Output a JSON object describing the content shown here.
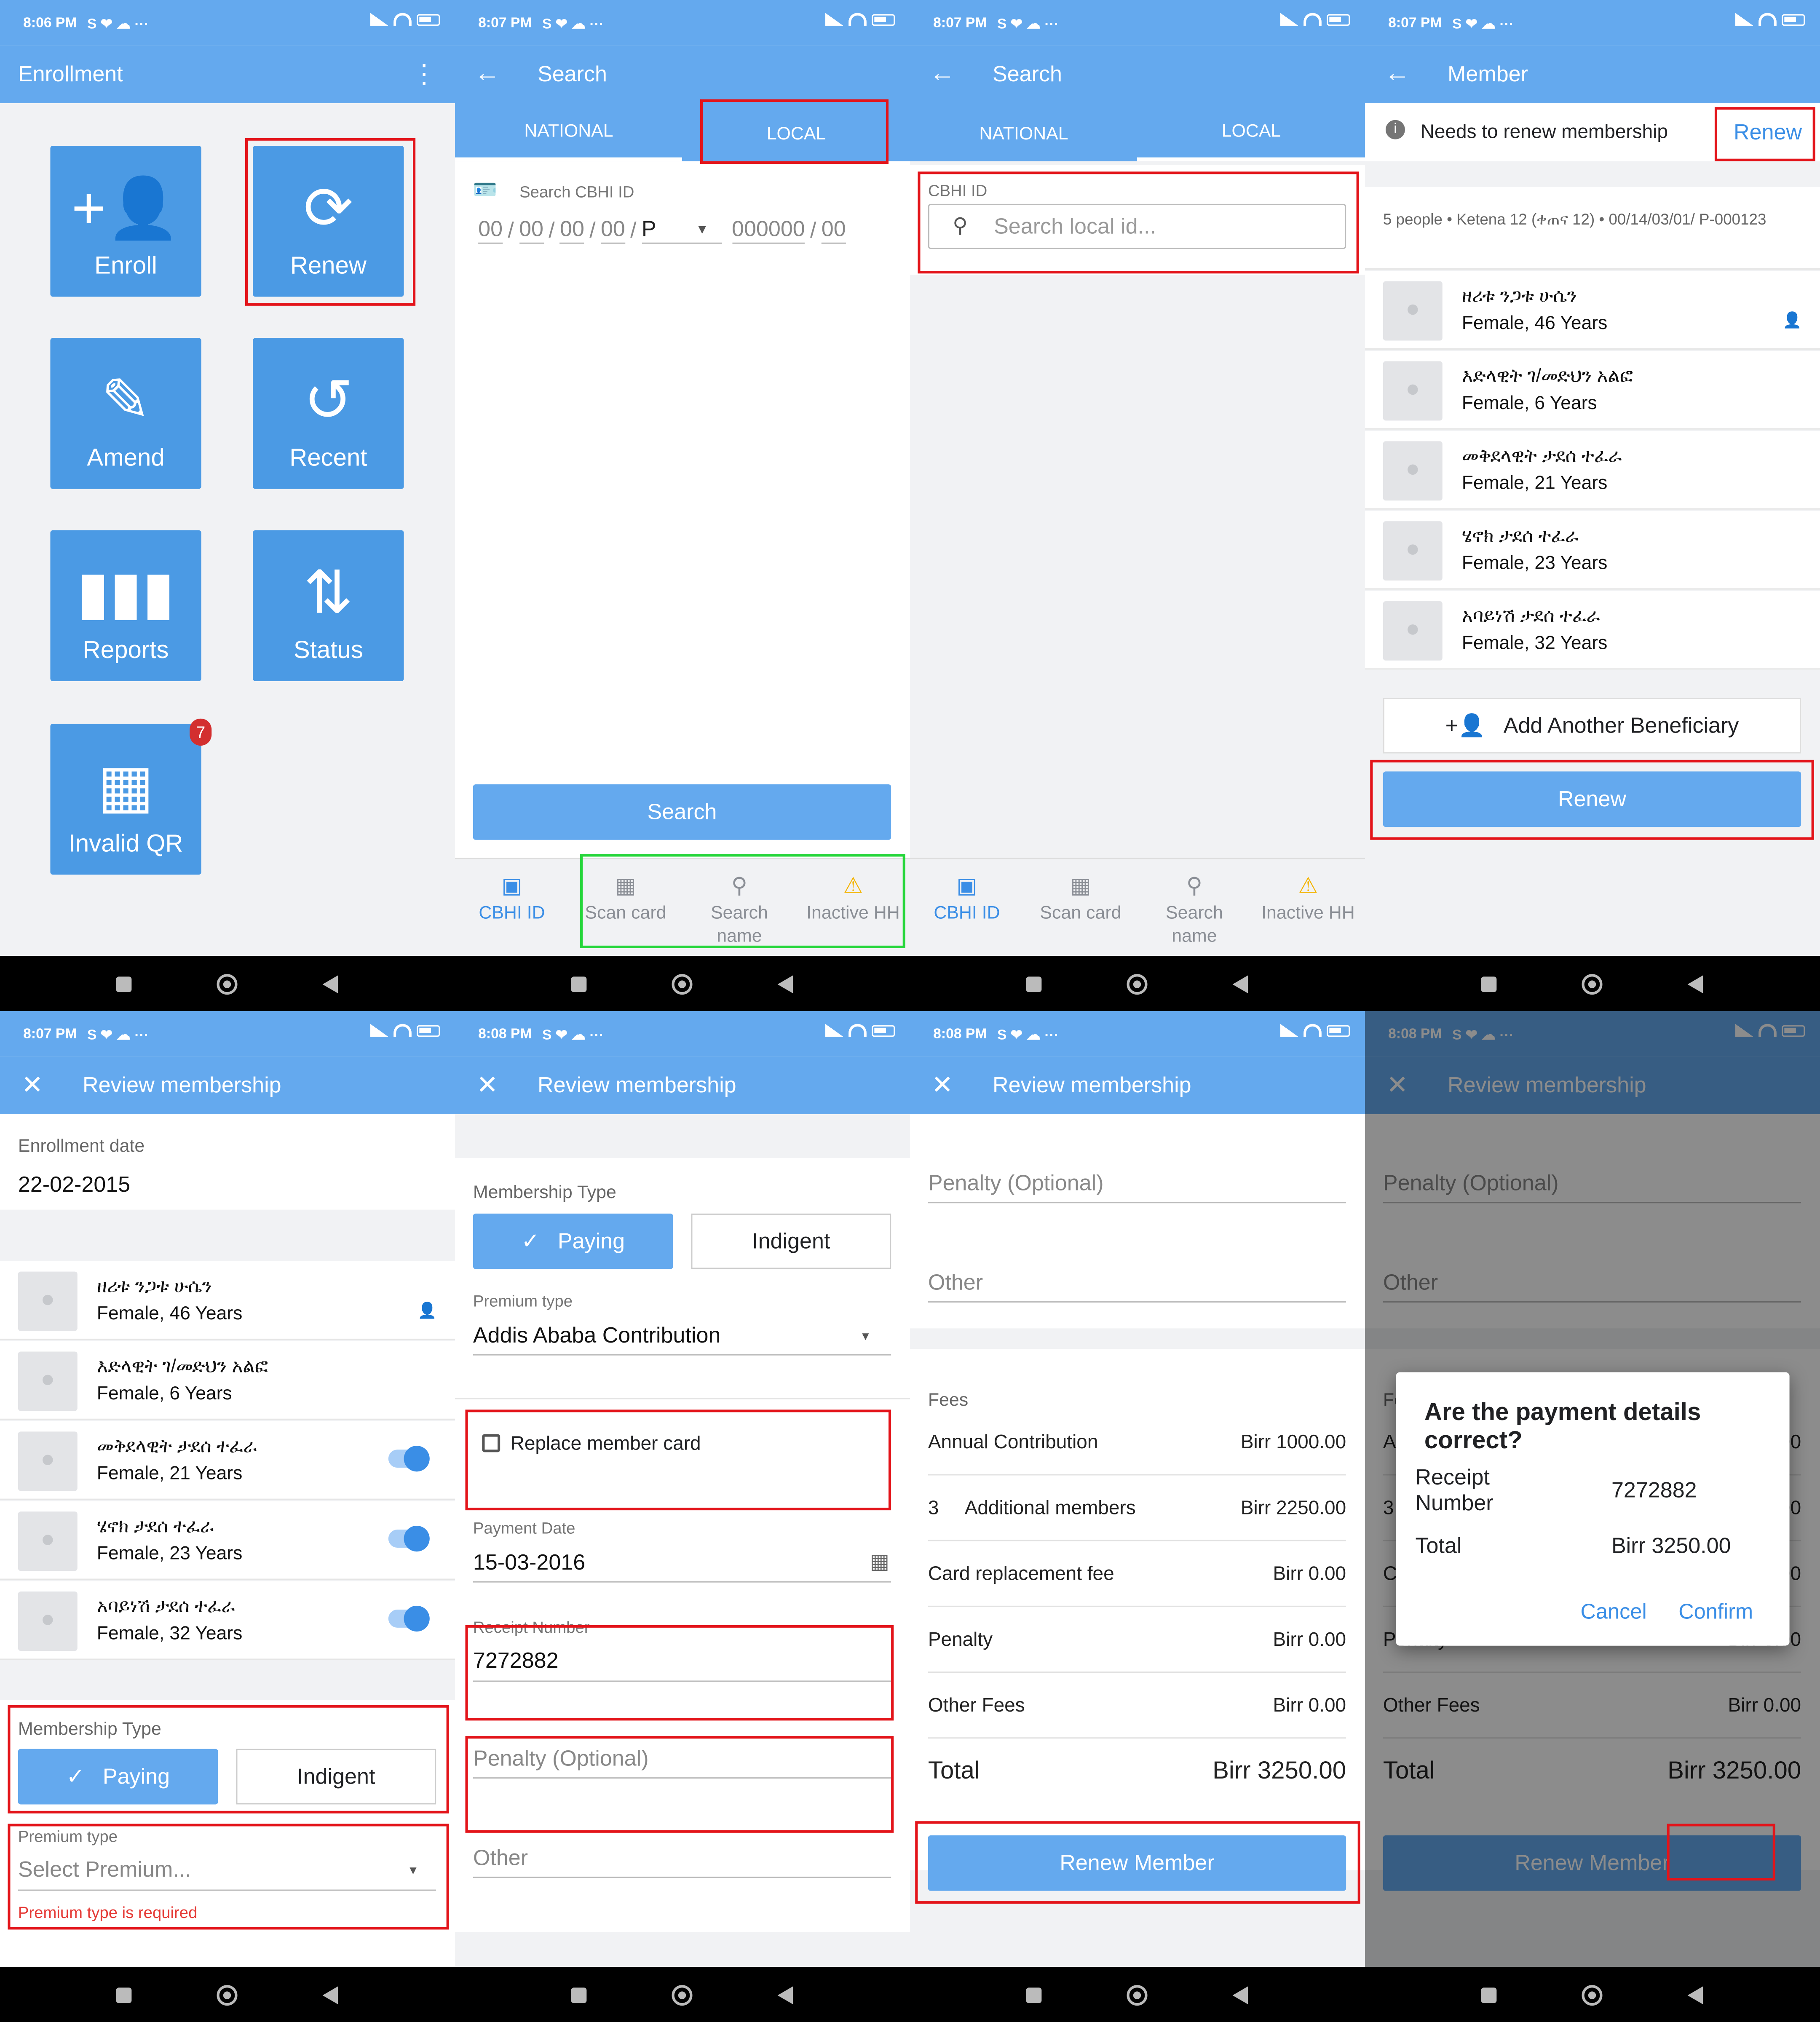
{
  "status": {
    "p1": "8:06 PM",
    "p2": "8:07 PM",
    "p3": "8:07 PM",
    "p4": "8:07 PM",
    "p5": "8:07 PM",
    "p6": "8:08 PM",
    "p7": "8:08 PM",
    "p8": "8:08 PM",
    "icons": "S ❤ ☁ ···"
  },
  "home": {
    "title": "Enrollment",
    "tiles": [
      "Enroll",
      "Renew",
      "Amend",
      "Recent",
      "Reports",
      "Status",
      "Invalid QR"
    ],
    "badge": "7"
  },
  "search": {
    "title": "Search",
    "tab_national": "NATIONAL",
    "tab_local": "LOCAL",
    "cbhi_label": "Search CBHI ID",
    "seg1": "00",
    "seg2": "00",
    "seg3": "00",
    "seg4": "00",
    "seg_p": "P",
    "seg5": "000000",
    "seg6": "00",
    "search_button": "Search",
    "bottom": [
      "CBHI ID",
      "Scan card",
      "Search name",
      "Inactive HH"
    ],
    "local_label": "CBHI ID",
    "local_placeholder": "Search local id..."
  },
  "member": {
    "title": "Member",
    "notice": "Needs to renew membership",
    "renew_link": "Renew",
    "summary": "5 people • Ketena 12 (ቀጠና 12) • 00/14/03/01/ P-000123",
    "add_button": "Add Another Beneficiary",
    "renew_button": "Renew"
  },
  "members": [
    {
      "name": "ዘሪቱ ንጋቱ ሁሴን",
      "info": "Female, 46 Years"
    },
    {
      "name": "እድላዊት ገ/መድህን አልፎ",
      "info": "Female, 6 Years"
    },
    {
      "name": "መቅደላዊት ታደሰ ተፈራ",
      "info": "Female, 21 Years"
    },
    {
      "name": "ሄኖክ ታደሰ ተፈራ",
      "info": "Female, 23 Years"
    },
    {
      "name": "አባይነሽ ታደሰ ተፈራ",
      "info": "Female, 32 Years"
    }
  ],
  "review": {
    "title": "Review membership",
    "enroll_label": "Enrollment date",
    "enroll_date": "22-02-2015",
    "membership_type": "Membership Type",
    "paying": "Paying",
    "indigent": "Indigent",
    "premium_label": "Premium type",
    "premium_placeholder": "Select Premium...",
    "premium_error": "Premium type is required",
    "premium_value": "Addis Ababa Contribution",
    "replace_card": "Replace member card",
    "payment_date_label": "Payment Date",
    "payment_date": "15-03-2016",
    "receipt_label": "Receipt Number",
    "receipt": "7272882",
    "penalty": "Penalty (Optional)",
    "other": "Other"
  },
  "fees": {
    "title": "Fees",
    "rows": [
      {
        "label": "Annual Contribution",
        "value": "Birr 1000.00"
      },
      {
        "label": "3     Additional members",
        "value": "Birr 2250.00"
      },
      {
        "label": "Card replacement fee",
        "value": "Birr 0.00"
      },
      {
        "label": "Penalty",
        "value": "Birr 0.00"
      },
      {
        "label": "Other Fees",
        "value": "Birr 0.00"
      }
    ],
    "total_label": "Total",
    "total": "Birr 3250.00",
    "button": "Renew Member"
  },
  "dialog": {
    "question": "Are the payment details correct?",
    "receipt_label": "Receipt Number",
    "receipt": "7272882",
    "total_label": "Total",
    "total": "Birr 3250.00",
    "cancel": "Cancel",
    "confirm": "Confirm"
  }
}
